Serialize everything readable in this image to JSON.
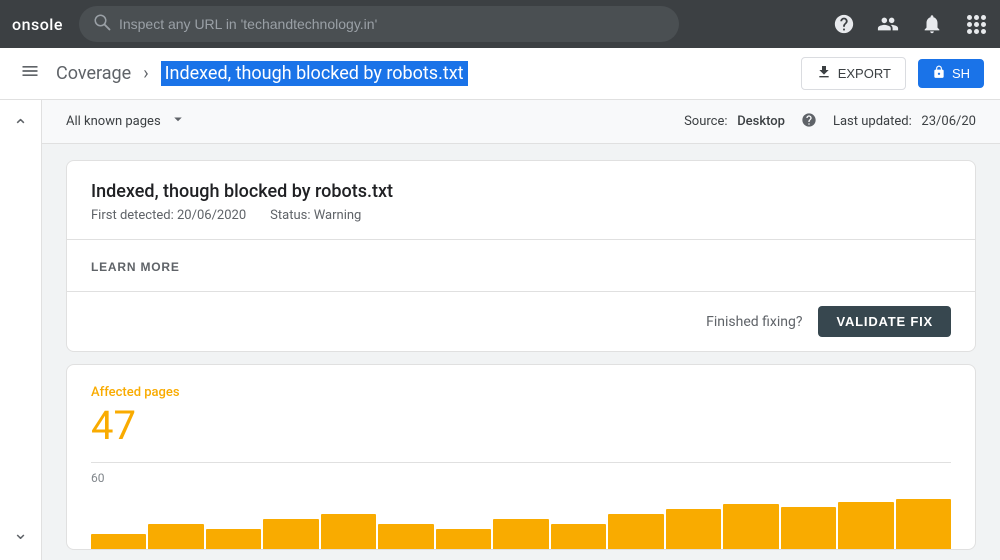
{
  "topbar": {
    "logo": "onsole",
    "search_placeholder": "Inspect any URL in 'techandtechnology.in'"
  },
  "breadcrumb": {
    "parent": "Coverage",
    "separator": "›",
    "current": "Indexed, though blocked by robots.txt",
    "export_label": "EXPORT",
    "share_label": "SH"
  },
  "filter_bar": {
    "label": "All known pages",
    "source_prefix": "Source:",
    "source_value": "Desktop",
    "last_updated_prefix": "Last updated:",
    "last_updated_value": "23/06/20"
  },
  "issue_card": {
    "title": "Indexed, though blocked by robots.txt",
    "first_detected_label": "First detected:",
    "first_detected_value": "20/06/2020",
    "status_label": "Status:",
    "status_value": "Warning",
    "learn_more": "LEARN MORE",
    "finished_fixing": "Finished fixing?",
    "validate_fix": "VALIDATE FIX"
  },
  "affected_card": {
    "label": "Affected pages",
    "count": "47",
    "chart_y_value": "60",
    "chart_bars": [
      0.3,
      0.5,
      0.4,
      0.6,
      0.7,
      0.5,
      0.4,
      0.6,
      0.5,
      0.7,
      0.8,
      0.9,
      0.85,
      0.95,
      1.0
    ]
  },
  "colors": {
    "accent_blue": "#1a73e8",
    "warning_orange": "#f9ab00",
    "dark_button": "#37474f"
  }
}
